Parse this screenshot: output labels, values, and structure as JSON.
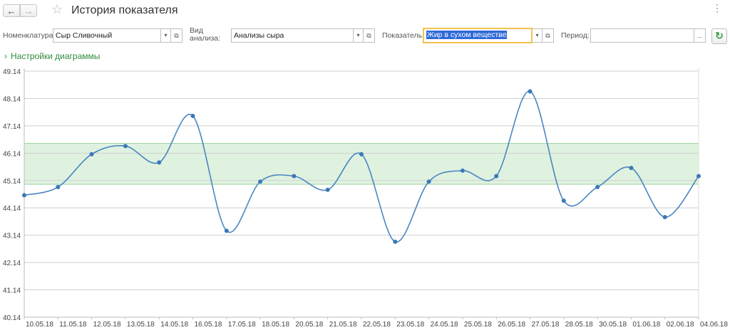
{
  "window": {
    "title": "История показателя",
    "back_icon": "arrow-left-icon",
    "forward_icon": "arrow-right-icon",
    "favorite_icon": "star-icon",
    "more_icon": "more-icon"
  },
  "filters": {
    "nomenclature_label": "Номенклатура:",
    "nomenclature_value": "Сыр Сливочный",
    "analysis_label_line1": "Вид",
    "analysis_label_line2": "анализа:",
    "analysis_value": "Анализы сыра",
    "indicator_label": "Показатель:",
    "indicator_value": "Жир в сухом веществе",
    "period_label": "Период:",
    "period_value": "",
    "period_button": "...",
    "refresh_icon": "refresh-icon"
  },
  "settings_link": "Настройки диаграммы",
  "colors": {
    "line": "#4a86c0",
    "point": "#3a78b8",
    "band": "#dff2e0",
    "band_edge": "#9fd4a3",
    "grid": "#cfcfcf",
    "link": "#2e8b3c",
    "focus_border": "#f2c14e"
  },
  "chart_data": {
    "type": "line",
    "x": [
      "10.05.18",
      "11.05.18",
      "12.05.18",
      "13.05.18",
      "14.05.18",
      "16.05.18",
      "17.05.18",
      "18.05.18",
      "20.05.18",
      "21.05.18",
      "22.05.18",
      "23.05.18",
      "24.05.18",
      "25.05.18",
      "26.05.18",
      "27.05.18",
      "28.05.18",
      "30.05.18",
      "01.06.18",
      "02.06.18",
      "04.06.18"
    ],
    "series": [
      {
        "values": [
          44.6,
          44.9,
          46.1,
          46.4,
          45.8,
          47.5,
          43.3,
          45.1,
          45.3,
          44.8,
          46.1,
          42.9,
          45.1,
          45.5,
          45.3,
          48.4,
          44.4,
          44.9,
          45.6,
          43.8,
          45.3
        ]
      }
    ],
    "y_ticks": [
      "49.14",
      "48.14",
      "47.14",
      "46.14",
      "45.14",
      "44.14",
      "43.14",
      "42.14",
      "41.14",
      "40.14"
    ],
    "ylim": [
      40.14,
      49.14
    ],
    "norm_band": [
      45.0,
      46.5
    ],
    "grid": true
  }
}
